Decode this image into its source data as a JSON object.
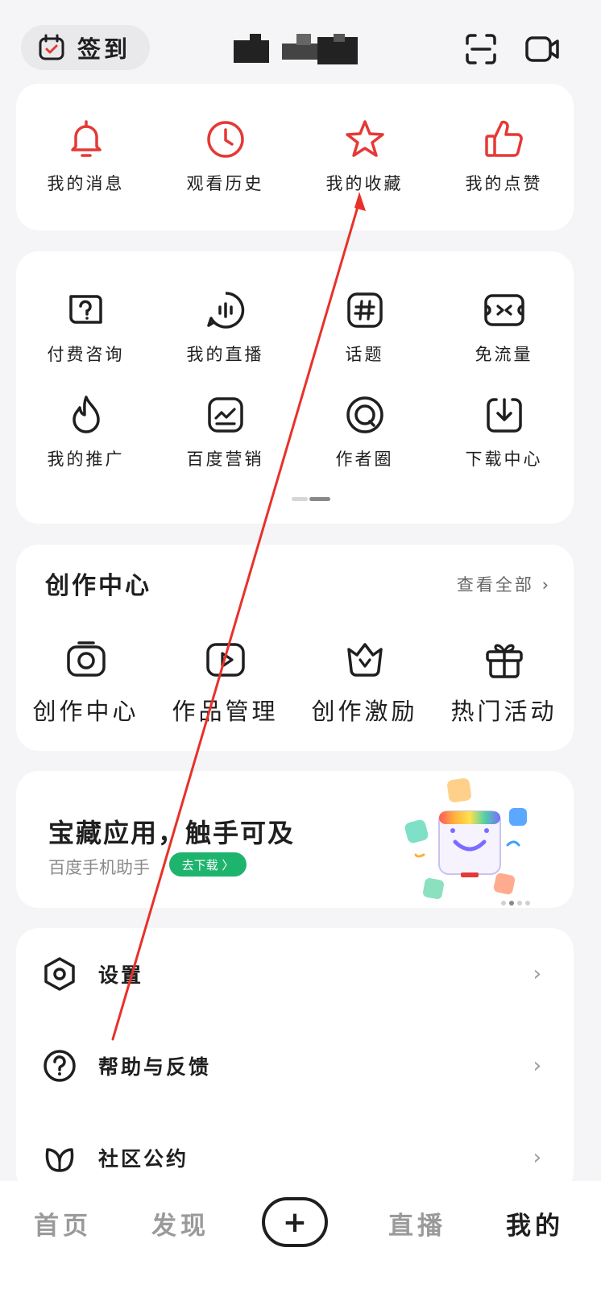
{
  "header": {
    "checkin_label": "签到",
    "icons": [
      "checkin-calendar-icon",
      "scan-icon",
      "video-camera-icon"
    ]
  },
  "quick_actions": [
    {
      "label": "我的消息",
      "icon": "bell-icon"
    },
    {
      "label": "观看历史",
      "icon": "clock-icon"
    },
    {
      "label": "我的收藏",
      "icon": "star-icon"
    },
    {
      "label": "我的点赞",
      "icon": "thumbs-up-icon"
    }
  ],
  "tools": [
    {
      "label": "付费咨询",
      "icon": "paid-consult-icon"
    },
    {
      "label": "我的直播",
      "icon": "live-icon"
    },
    {
      "label": "话题",
      "icon": "hashtag-icon"
    },
    {
      "label": "免流量",
      "icon": "free-data-icon"
    },
    {
      "label": "我的推广",
      "icon": "flame-icon"
    },
    {
      "label": "百度营销",
      "icon": "marketing-icon"
    },
    {
      "label": "作者圈",
      "icon": "author-circle-icon"
    },
    {
      "label": "下载中心",
      "icon": "download-icon"
    }
  ],
  "creation_center": {
    "title": "创作中心",
    "see_all": "查看全部",
    "items": [
      {
        "label": "创作中心",
        "icon": "camera-icon"
      },
      {
        "label": "作品管理",
        "icon": "video-play-icon"
      },
      {
        "label": "创作激励",
        "icon": "crown-icon"
      },
      {
        "label": "热门活动",
        "icon": "gift-icon"
      }
    ]
  },
  "promo": {
    "title": "宝藏应用，触手可及",
    "subtitle": "百度手机助手",
    "button": "去下载 〉"
  },
  "settings_list": [
    {
      "label": "设置",
      "icon": "settings-hexagon-icon"
    },
    {
      "label": "帮助与反馈",
      "icon": "help-icon"
    },
    {
      "label": "社区公约",
      "icon": "community-leaf-icon"
    }
  ],
  "tabbar": {
    "home": "首页",
    "discover": "发现",
    "live": "直播",
    "me": "我的"
  },
  "colors": {
    "accent_red": "#e53935",
    "promo_green": "#1fb46e",
    "background": "#f5f5f7"
  }
}
